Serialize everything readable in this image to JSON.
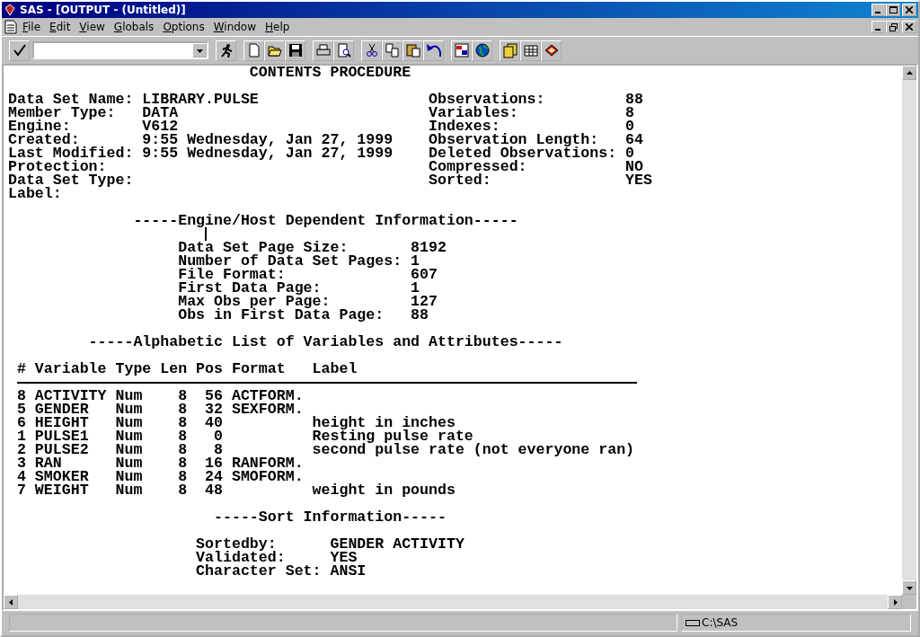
{
  "window": {
    "title": "SAS - [OUTPUT - (Untitled)]"
  },
  "menu": [
    {
      "label": "File"
    },
    {
      "label": "Edit"
    },
    {
      "label": "View"
    },
    {
      "label": "Globals"
    },
    {
      "label": "Options"
    },
    {
      "label": "Window"
    },
    {
      "label": "Help"
    }
  ],
  "output": {
    "lines": [
      {
        "kind": "text",
        "text": "                           CONTENTS PROCEDURE"
      },
      {
        "kind": "blank"
      },
      {
        "kind": "text",
        "text": "Data Set Name: LIBRARY.PULSE                   Observations:         88"
      },
      {
        "kind": "text",
        "text": "Member Type:   DATA                            Variables:            8"
      },
      {
        "kind": "text",
        "text": "Engine:        V612                            Indexes:              0"
      },
      {
        "kind": "text",
        "text": "Created:       9:55 Wednesday, Jan 27, 1999    Observation Length:   64"
      },
      {
        "kind": "text",
        "text": "Last Modified: 9:55 Wednesday, Jan 27, 1999    Deleted Observations: 0"
      },
      {
        "kind": "text",
        "text": "Protection:                                    Compressed:           NO"
      },
      {
        "kind": "text",
        "text": "Data Set Type:                                 Sorted:               YES"
      },
      {
        "kind": "text",
        "text": "Label:"
      },
      {
        "kind": "blank"
      },
      {
        "kind": "text",
        "text": "              -----Engine/Host Dependent Information-----"
      },
      {
        "kind": "cursor"
      },
      {
        "kind": "text",
        "text": "                   Data Set Page Size:       8192"
      },
      {
        "kind": "text",
        "text": "                   Number of Data Set Pages: 1"
      },
      {
        "kind": "text",
        "text": "                   File Format:              607"
      },
      {
        "kind": "text",
        "text": "                   First Data Page:          1"
      },
      {
        "kind": "text",
        "text": "                   Max Obs per Page:         127"
      },
      {
        "kind": "text",
        "text": "                   Obs in First Data Page:   88"
      },
      {
        "kind": "blank"
      },
      {
        "kind": "text",
        "text": "         -----Alphabetic List of Variables and Attributes-----"
      },
      {
        "kind": "blank"
      },
      {
        "kind": "text",
        "text": " # Variable Type Len Pos Format   Label"
      },
      {
        "kind": "rule"
      },
      {
        "kind": "text",
        "text": " 8 ACTIVITY Num    8  56 ACTFORM."
      },
      {
        "kind": "text",
        "text": " 5 GENDER   Num    8  32 SEXFORM."
      },
      {
        "kind": "text",
        "text": " 6 HEIGHT   Num    8  40          height in inches"
      },
      {
        "kind": "text",
        "text": " 1 PULSE1   Num    8   0          Resting pulse rate"
      },
      {
        "kind": "text",
        "text": " 2 PULSE2   Num    8   8          second pulse rate (not everyone ran)"
      },
      {
        "kind": "text",
        "text": " 3 RAN      Num    8  16 RANFORM."
      },
      {
        "kind": "text",
        "text": " 4 SMOKER   Num    8  24 SMOFORM."
      },
      {
        "kind": "text",
        "text": " 7 WEIGHT   Num    8  48          weight in pounds"
      },
      {
        "kind": "blank"
      },
      {
        "kind": "text",
        "text": "                       -----Sort Information-----"
      },
      {
        "kind": "blank"
      },
      {
        "kind": "text",
        "text": "                     Sortedby:      GENDER ACTIVITY"
      },
      {
        "kind": "text",
        "text": "                     Validated:     YES"
      },
      {
        "kind": "text",
        "text": "                     Character Set: ANSI"
      }
    ]
  },
  "status_bar": {
    "path": "C:\\SAS"
  }
}
